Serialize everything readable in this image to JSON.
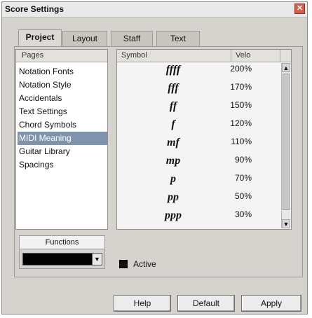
{
  "window": {
    "title": "Score Settings",
    "close_glyph": "✕"
  },
  "tabs": [
    {
      "label": "Project",
      "active": true
    },
    {
      "label": "Layout",
      "active": false
    },
    {
      "label": "Staff",
      "active": false
    },
    {
      "label": "Text",
      "active": false
    }
  ],
  "pages": {
    "header": "Pages",
    "items": [
      "Notation Fonts",
      "Notation Style",
      "Accidentals",
      "Text Settings",
      "Chord Symbols",
      "MIDI Meaning",
      "Guitar Library",
      "Spacings"
    ],
    "selected_index": 5
  },
  "symbol_table": {
    "headers": {
      "symbol": "Symbol",
      "velo": "Velo"
    },
    "rows": [
      {
        "symbol": "ffff",
        "velo": "200%"
      },
      {
        "symbol": "fff",
        "velo": "170%"
      },
      {
        "symbol": "ff",
        "velo": "150%"
      },
      {
        "symbol": "f",
        "velo": "120%"
      },
      {
        "symbol": "mf",
        "velo": "110%"
      },
      {
        "symbol": "mp",
        "velo": "90%"
      },
      {
        "symbol": "p",
        "velo": "70%"
      },
      {
        "symbol": "pp",
        "velo": "50%"
      },
      {
        "symbol": "ppp",
        "velo": "30%"
      }
    ]
  },
  "functions": {
    "label": "Functions",
    "value": ""
  },
  "active": {
    "label": "Active",
    "checked": true
  },
  "buttons": {
    "help": "Help",
    "default": "Default",
    "apply": "Apply"
  },
  "colors": {
    "selection": "#7f93ac",
    "dialog_bg": "#d6d3ce"
  }
}
